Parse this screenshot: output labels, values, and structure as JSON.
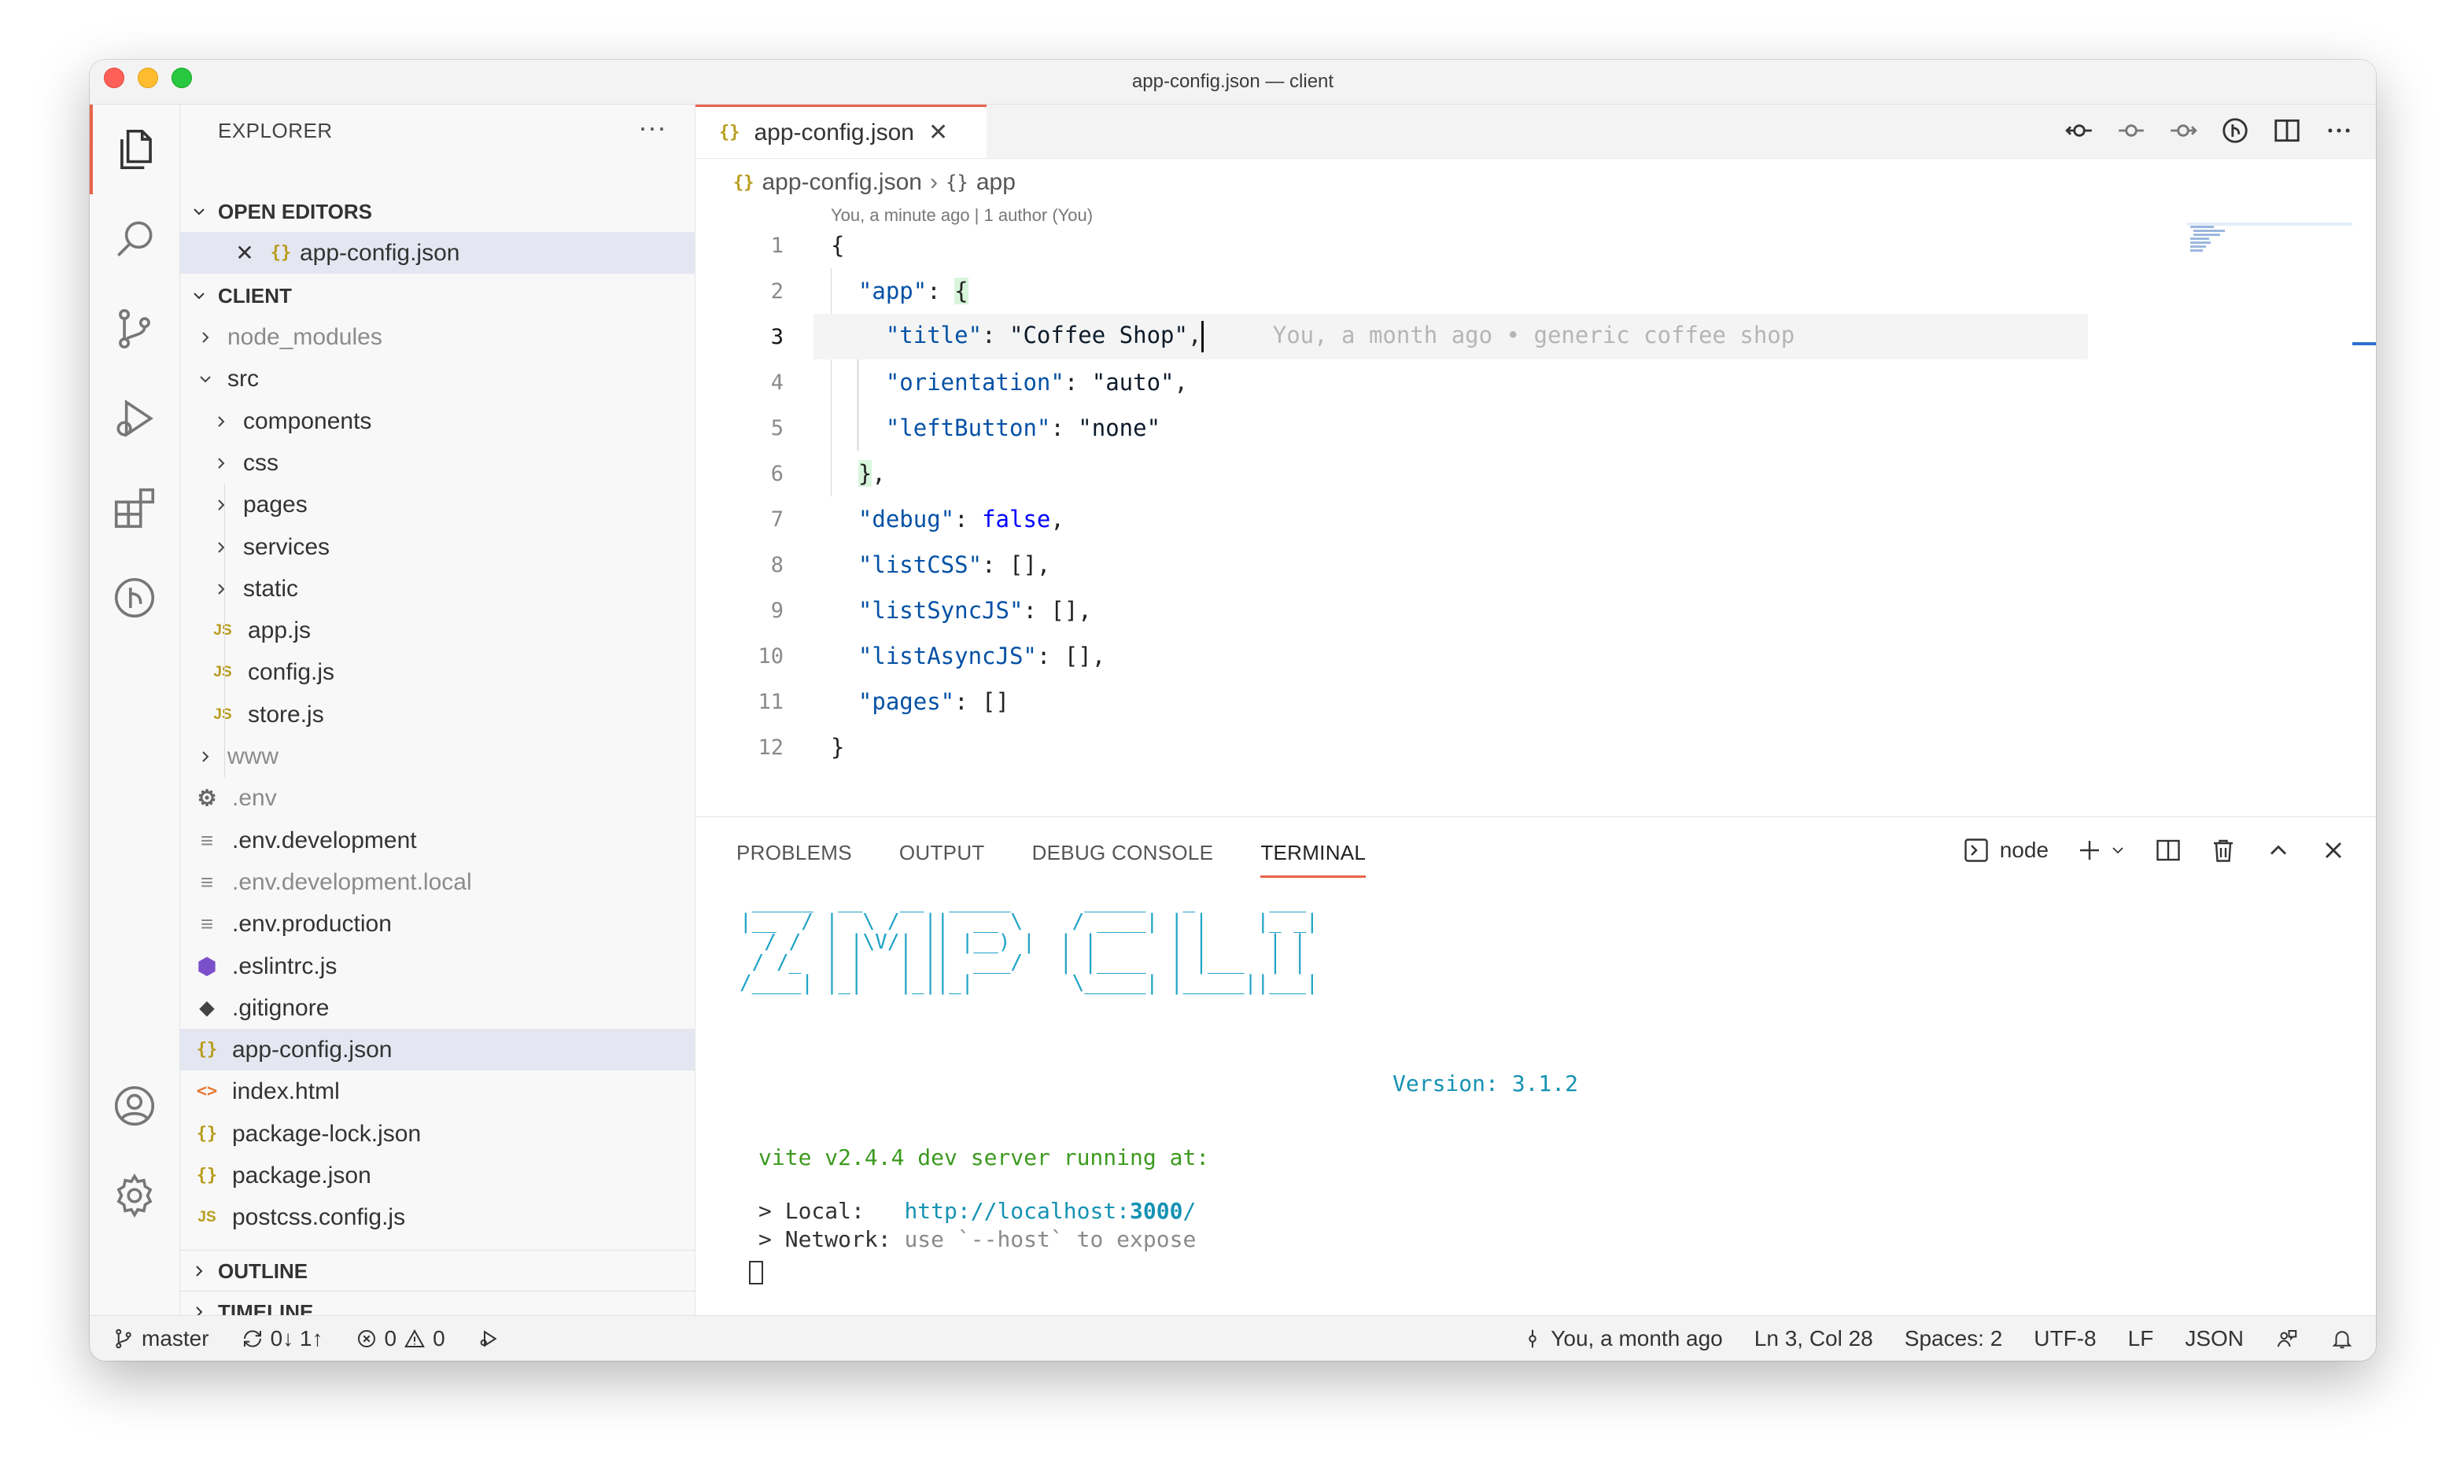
{
  "window": {
    "title": "app-config.json — client"
  },
  "sidebar": {
    "header": "EXPLORER",
    "more": "···",
    "open_editors_label": "OPEN EDITORS",
    "open_editor_file": "app-config.json",
    "project_label": "CLIENT",
    "tree": [
      {
        "name": "node_modules",
        "kind": "folder",
        "depth": 0,
        "muted": true
      },
      {
        "name": "src",
        "kind": "folder-open",
        "depth": 0
      },
      {
        "name": "components",
        "kind": "folder",
        "depth": 1
      },
      {
        "name": "css",
        "kind": "folder",
        "depth": 1
      },
      {
        "name": "pages",
        "kind": "folder",
        "depth": 1
      },
      {
        "name": "services",
        "kind": "folder",
        "depth": 1
      },
      {
        "name": "static",
        "kind": "folder",
        "depth": 1
      },
      {
        "name": "app.js",
        "kind": "js",
        "depth": 1
      },
      {
        "name": "config.js",
        "kind": "js",
        "depth": 1
      },
      {
        "name": "store.js",
        "kind": "js",
        "depth": 1
      },
      {
        "name": "www",
        "kind": "folder",
        "depth": 0,
        "muted": true
      },
      {
        "name": ".env",
        "kind": "gear",
        "depth": 0,
        "muted": true
      },
      {
        "name": ".env.development",
        "kind": "lines",
        "depth": 0
      },
      {
        "name": ".env.development.local",
        "kind": "lines",
        "depth": 0,
        "muted": true
      },
      {
        "name": ".env.production",
        "kind": "lines",
        "depth": 0
      },
      {
        "name": ".eslintrc.js",
        "kind": "eslint",
        "depth": 0
      },
      {
        "name": ".gitignore",
        "kind": "git",
        "depth": 0
      },
      {
        "name": "app-config.json",
        "kind": "json",
        "depth": 0,
        "selected": true
      },
      {
        "name": "index.html",
        "kind": "html",
        "depth": 0
      },
      {
        "name": "package-lock.json",
        "kind": "json",
        "depth": 0
      },
      {
        "name": "package.json",
        "kind": "json",
        "depth": 0
      },
      {
        "name": "postcss.config.js",
        "kind": "js",
        "depth": 0
      }
    ],
    "outline_label": "OUTLINE",
    "timeline_label": "TIMELINE"
  },
  "editor": {
    "tab_label": "app-config.json",
    "breadcrumb_file": "app-config.json",
    "breadcrumb_symbol": "app",
    "blame_header": "You, a minute ago | 1 author (You)",
    "inline_blame": "You, a month ago • generic coffee shop",
    "line_numbers": [
      "1",
      "2",
      "3",
      "4",
      "5",
      "6",
      "7",
      "8",
      "9",
      "10",
      "11",
      "12"
    ]
  },
  "panel": {
    "tabs": [
      "PROBLEMS",
      "OUTPUT",
      "DEBUG CONSOLE",
      "TERMINAL"
    ],
    "active_tab": "TERMINAL",
    "terminal_name": "node",
    "version": "Version: 3.1.2",
    "vite_line": "vite v2.4.4 dev server running at:",
    "local_label": "> Local:   ",
    "local_url_prefix": "http://localhost:",
    "local_url_port": "3000",
    "local_url_suffix": "/",
    "network_label": "> Network: ",
    "network_text": "use `--host` to expose"
  },
  "statusbar": {
    "branch": "master",
    "sync": "0↓ 1↑",
    "errors": "0",
    "warnings": "0",
    "blame": "You, a month ago",
    "position": "Ln 3, Col 28",
    "spaces": "Spaces: 2",
    "encoding": "UTF-8",
    "eol": "LF",
    "language": "JSON"
  },
  "colors": {
    "accent": "#e8634a",
    "json_icon": "#b89c1d",
    "json_key": "#0451a5",
    "keyword": "#0000ff",
    "terminal_cyan": "#1fa3c6",
    "terminal_green": "#3c9a1f"
  }
}
